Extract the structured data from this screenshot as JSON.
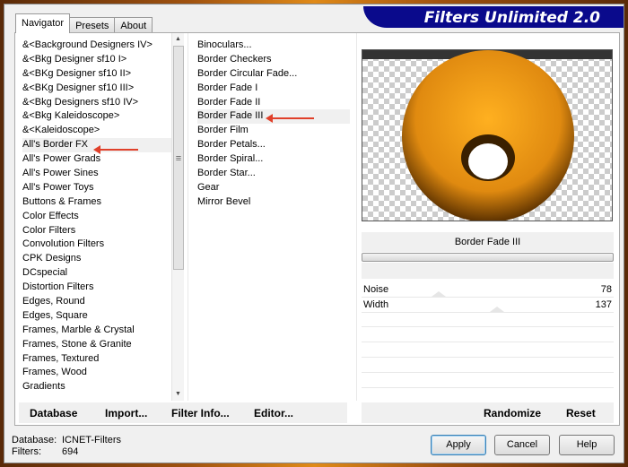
{
  "title": "Filters Unlimited 2.0",
  "tabs": [
    {
      "label": "Navigator",
      "active": true
    },
    {
      "label": "Presets"
    },
    {
      "label": "About"
    }
  ],
  "categories": [
    "&<Background Designers IV>",
    "&<Bkg Designer sf10 I>",
    "&<BKg Designer sf10 II>",
    "&<BKg Designer sf10 III>",
    "&<Bkg Designers sf10 IV>",
    "&<Bkg Kaleidoscope>",
    "&<Kaleidoscope>",
    "All's Border FX",
    "All's Power Grads",
    "All's Power Sines",
    "All's Power Toys",
    "Buttons & Frames",
    "Color Effects",
    "Color Filters",
    "Convolution Filters",
    "CPK Designs",
    "DCspecial",
    "Distortion Filters",
    "Edges, Round",
    "Edges, Square",
    "Frames, Marble & Crystal",
    "Frames, Stone & Granite",
    "Frames, Textured",
    "Frames, Wood",
    "Gradients"
  ],
  "selected_category": "All's Border FX",
  "filters": [
    "Binoculars...",
    "Border Checkers",
    "Border Circular Fade...",
    "Border Fade I",
    "Border Fade II",
    "Border Fade III",
    "Border Film",
    "Border Petals...",
    "Border Spiral...",
    "Border Star...",
    "Gear",
    "Mirror Bevel"
  ],
  "selected_filter": "Border Fade III",
  "filter_name": "Border Fade III",
  "params": [
    {
      "label": "Noise",
      "value": "78",
      "fraction": 0.306
    },
    {
      "label": "Width",
      "value": "137",
      "fraction": 0.537
    }
  ],
  "bottom_left": {
    "database": "Database",
    "import": "Import...",
    "filter_info": "Filter Info...",
    "editor": "Editor..."
  },
  "bottom_right": {
    "randomize": "Randomize",
    "reset": "Reset"
  },
  "status": {
    "database_label": "Database:",
    "database_value": "ICNET-Filters",
    "filters_label": "Filters:",
    "filters_value": "694"
  },
  "buttons": {
    "apply": "Apply",
    "cancel": "Cancel",
    "help": "Help"
  },
  "colors": {
    "logo_bg": "#0a0a8c",
    "arrow": "#e0402a"
  }
}
